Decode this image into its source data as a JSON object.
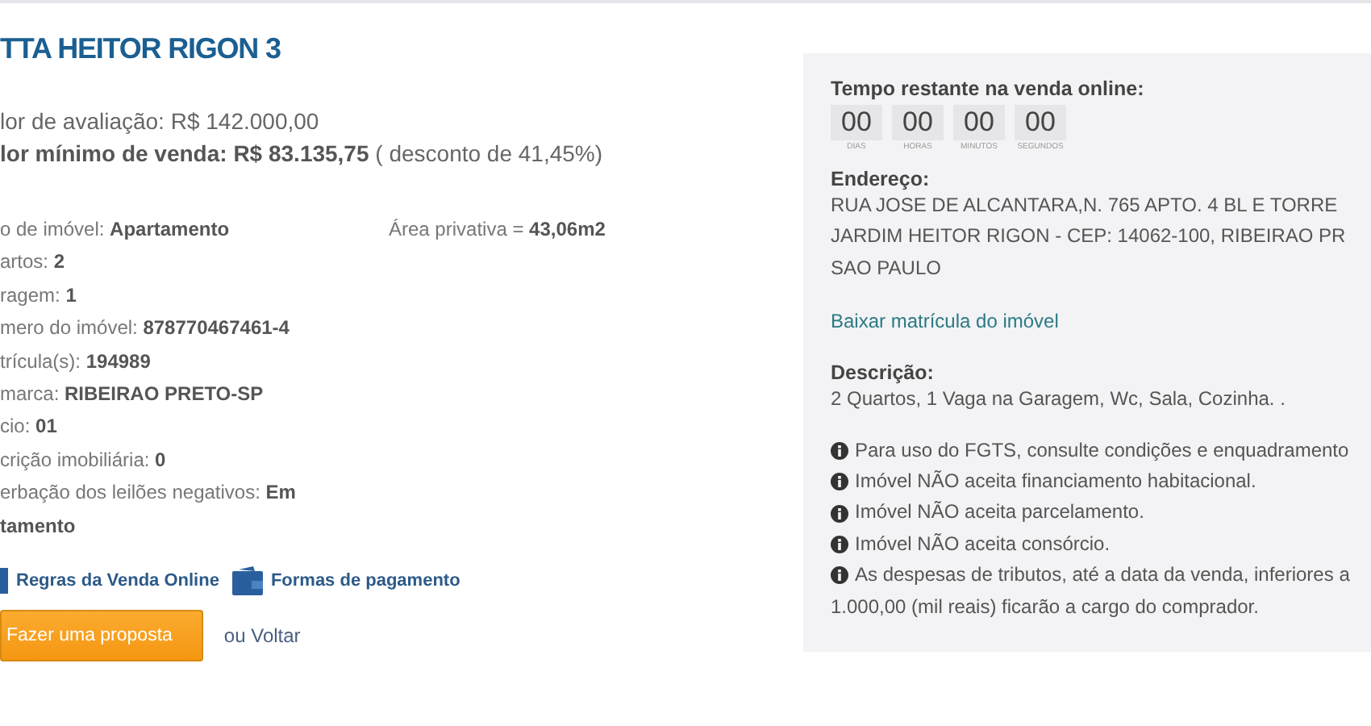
{
  "title": "TTA HEITOR RIGON 3",
  "prices": [
    {
      "label": "lor de avaliação:",
      "value": "R$ 142.000,00",
      "bold": false
    },
    {
      "label": "lor mínimo de venda:",
      "value": "R$ 83.135,75",
      "bold": true,
      "note": "( desconto de 41,45%)"
    }
  ],
  "fields": [
    {
      "label": "o de imóvel:",
      "value": "Apartamento"
    },
    {
      "label": "artos:",
      "value": "2"
    },
    {
      "label": "ragem:",
      "value": "1"
    },
    {
      "label": "mero do imóvel:",
      "value": "878770467461-4"
    },
    {
      "label": "trícula(s):",
      "value": "194989"
    },
    {
      "label": "marca:",
      "value": "RIBEIRAO PRETO-SP"
    },
    {
      "label": "cio:",
      "value": "01"
    },
    {
      "label": "crição imobiliária:",
      "value": "0"
    },
    {
      "label": "erbação dos leilões negativos:",
      "value": "Em",
      "continued": "tamento"
    }
  ],
  "area": {
    "label": "Área privativa =",
    "value": "43,06m2"
  },
  "links": [
    {
      "kind": "book",
      "label": "Regras da Venda Online"
    },
    {
      "kind": "wallet",
      "label": "Formas de pagamento"
    }
  ],
  "proposal_button": "Fazer uma proposta",
  "back_link": "ou Voltar",
  "panel": {
    "timer_title": "Tempo restante na venda online:",
    "countdown": [
      {
        "value": "00",
        "unit": "DIAS"
      },
      {
        "value": "00",
        "unit": "HORAS"
      },
      {
        "value": "00",
        "unit": "MINUTOS"
      },
      {
        "value": "00",
        "unit": "SEGUNDOS"
      }
    ],
    "address_title": "Endereço:",
    "address_lines": [
      "RUA JOSE DE ALCANTARA,N. 765 APTO. 4 BL E TORRE",
      "JARDIM HEITOR RIGON - CEP: 14062-100, RIBEIRAO PR",
      "SAO PAULO"
    ],
    "download_link": "Baixar matrícula do imóvel",
    "description_title": "Descrição:",
    "description": "2 Quartos, 1 Vaga na Garagem, Wc, Sala, Cozinha. .",
    "notices": [
      {
        "text": "Para uso do FGTS, consulte condições e enquadramento"
      },
      {
        "text": "Imóvel NÃO aceita financiamento habitacional."
      },
      {
        "text": "Imóvel NÃO aceita parcelamento."
      },
      {
        "text": "Imóvel NÃO aceita consórcio."
      },
      {
        "text": "As despesas de tributos, até a data da venda, inferiores a",
        "continued": "1.000,00 (mil reais) ficarão a cargo do comprador."
      }
    ]
  }
}
